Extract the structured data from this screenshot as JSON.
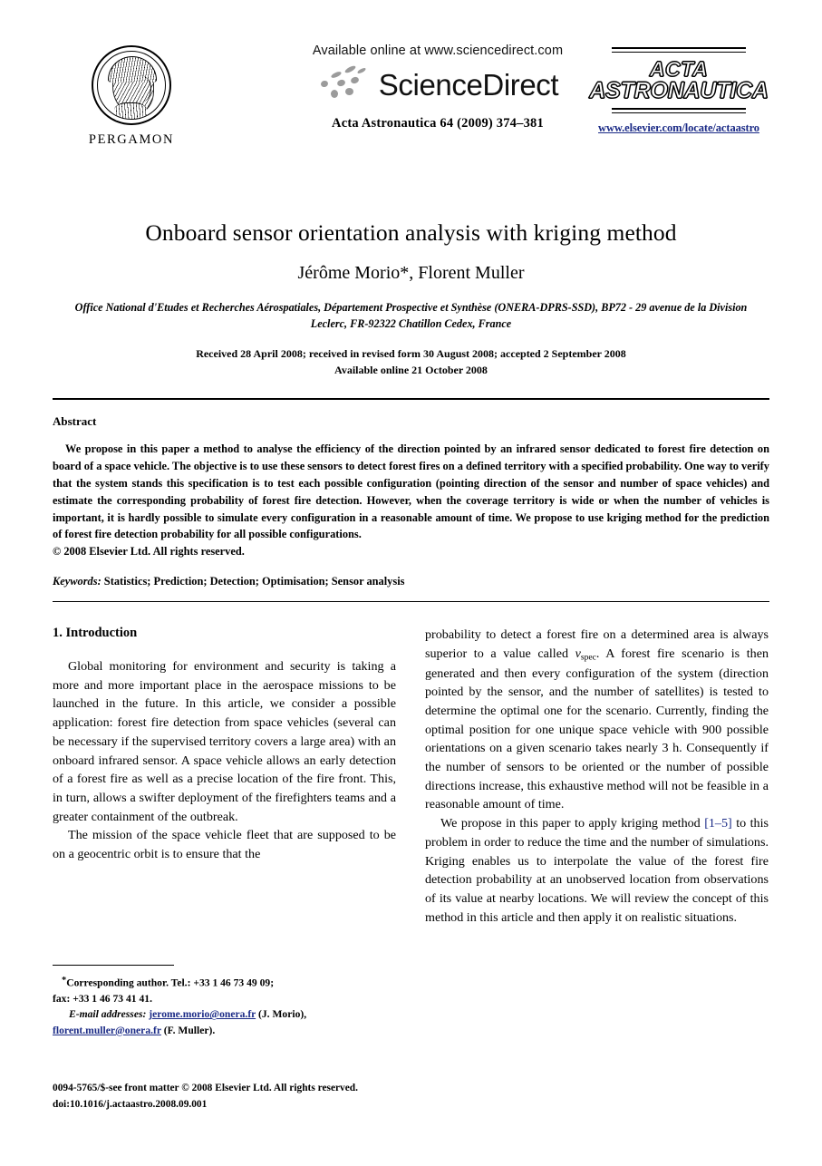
{
  "masthead": {
    "publisher_logo_word": "PERGAMON",
    "available_online": "Available online at www.sciencedirect.com",
    "sciencedirect_wordmark": "ScienceDirect",
    "journal_citation": "Acta Astronautica 64 (2009) 374–381",
    "journal_logo_line1": "ACTA",
    "journal_logo_line2": "ASTRONAUTICA",
    "journal_url": "www.elsevier.com/locate/actaastro"
  },
  "article": {
    "title": "Onboard sensor orientation analysis with kriging method",
    "authors": "Jérôme Morio*, Florent Muller",
    "affiliation": "Office National d'Etudes et Recherches Aérospatiales, Département Prospective et Synthèse (ONERA-DPRS-SSD), BP72 - 29 avenue de la Division Leclerc, FR-92322 Chatillon Cedex, France",
    "received_line": "Received 28 April 2008; received in revised form 30 August 2008; accepted 2 September 2008",
    "available_line": "Available online 21 October 2008"
  },
  "abstract": {
    "heading": "Abstract",
    "text": "We propose in this paper a method to analyse the efficiency of the direction pointed by an infrared sensor dedicated to forest fire detection on board of a space vehicle. The objective is to use these sensors to detect forest fires on a defined territory with a specified probability. One way to verify that the system stands this specification is to test each possible configuration (pointing direction of the sensor and number of space vehicles) and estimate the corresponding probability of forest fire detection. However, when the coverage territory is wide or when the number of vehicles is important, it is hardly possible to simulate every configuration in a reasonable amount of time. We propose to use kriging method for the prediction of forest fire detection probability for all possible configurations.",
    "copyright": "© 2008 Elsevier Ltd. All rights reserved.",
    "keywords_label": "Keywords:",
    "keywords_value": " Statistics; Prediction; Detection; Optimisation; Sensor analysis"
  },
  "body": {
    "section_heading": "1. Introduction",
    "left_para_1": "Global monitoring for environment and security is taking a more and more important place in the aerospace missions to be launched in the future. In this article, we consider a possible application: forest fire detection from space vehicles (several can be necessary if the supervised territory covers a large area) with an onboard infrared sensor. A space vehicle allows an early detection of a forest fire as well as a precise location of the fire front. This, in turn, allows a swifter deployment of the firefighters teams and a greater containment of the outbreak.",
    "left_para_2_start": "The mission of the space vehicle fleet that are supposed to be on a geocentric orbit is to ensure that the",
    "right_para_2_cont_a": "probability to detect a forest fire on a determined area is always superior to a value called ",
    "right_para_2_var": "v",
    "right_para_2_var_sub": "spec",
    "right_para_2_cont_b": ". A forest fire scenario is then generated and then every configuration of the system (direction pointed by the sensor, and the number of satellites) is tested to determine the optimal one for the scenario. Currently, finding the optimal position for one unique space vehicle with 900 possible orientations on a given scenario takes nearly 3 h. Consequently if the number of sensors to be oriented or the number of possible directions increase, this exhaustive method will not be feasible in a reasonable amount of time.",
    "right_para_3_a": "We propose in this paper to apply kriging method ",
    "right_para_3_cite": "[1–5]",
    "right_para_3_b": " to this problem in order to reduce the time and the number of simulations. Kriging enables us to interpolate the value of the forest fire detection probability at an unobserved location from observations of its value at nearby locations. We will review the concept of this method in this article and then apply it on realistic situations."
  },
  "footnote": {
    "corresponding_star": "*",
    "corresponding_text": "Corresponding author. Tel.: +33 1 46 73 49 09;",
    "fax_text": "fax: +33 1 46 73 41 41.",
    "email_label": "E-mail addresses:",
    "email1": "jerome.morio@onera.fr",
    "email1_owner": " (J. Morio),",
    "email2": "florent.muller@onera.fr",
    "email2_owner": " (F. Muller)."
  },
  "colophon": {
    "issn_line": "0094-5765/$-see front matter © 2008 Elsevier Ltd. All rights reserved.",
    "doi_line": "doi:10.1016/j.actaastro.2008.09.001"
  },
  "colors": {
    "link_navy": "#1a2a86",
    "swoosh_gray": "#9b9b9b"
  }
}
